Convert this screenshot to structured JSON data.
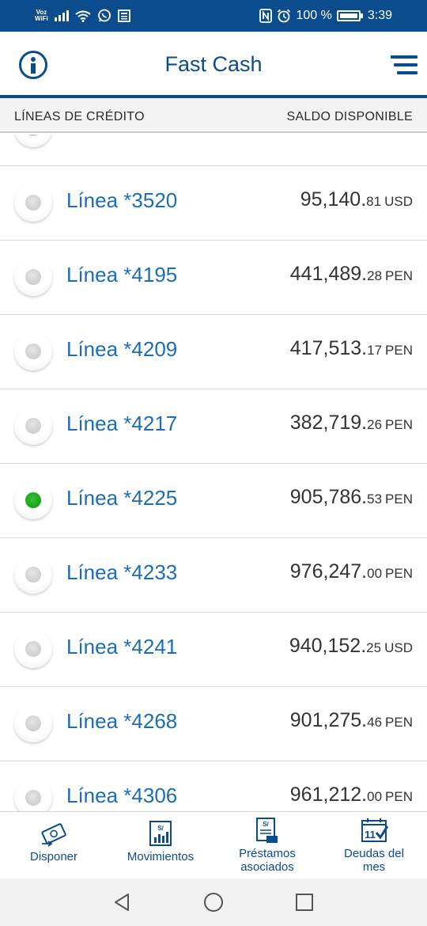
{
  "status_bar": {
    "carrier_top": "Voz",
    "carrier_bottom": "WiFi",
    "battery": "100 %",
    "time": "3:39"
  },
  "header": {
    "title": "Fast Cash",
    "info_icon": "info-icon",
    "menu_icon": "hamburger-menu-icon"
  },
  "columns": {
    "left": "LÍNEAS DE CRÉDITO",
    "right": "SALDO DISPONIBLE"
  },
  "lines": [
    {
      "label": "Línea *3520",
      "int": "95,140.",
      "dec": "81",
      "cur": "USD",
      "selected": false
    },
    {
      "label": "Línea *4195",
      "int": "441,489.",
      "dec": "28",
      "cur": "PEN",
      "selected": false
    },
    {
      "label": "Línea *4209",
      "int": "417,513.",
      "dec": "17",
      "cur": "PEN",
      "selected": false
    },
    {
      "label": "Línea *4217",
      "int": "382,719.",
      "dec": "26",
      "cur": "PEN",
      "selected": false
    },
    {
      "label": "Línea *4225",
      "int": "905,786.",
      "dec": "53",
      "cur": "PEN",
      "selected": true
    },
    {
      "label": "Línea *4233",
      "int": "976,247.",
      "dec": "00",
      "cur": "PEN",
      "selected": false
    },
    {
      "label": "Línea *4241",
      "int": "940,152.",
      "dec": "25",
      "cur": "USD",
      "selected": false
    },
    {
      "label": "Línea *4268",
      "int": "901,275.",
      "dec": "46",
      "cur": "PEN",
      "selected": false
    },
    {
      "label": "Línea *4306",
      "int": "961,212.",
      "dec": "00",
      "cur": "PEN",
      "selected": false
    }
  ],
  "bottom_nav": {
    "disponer": "Disponer",
    "movimientos": "Movimientos",
    "prestamos_1": "Préstamos",
    "prestamos_2": "asociados",
    "deudas_1": "Deudas del",
    "deudas_2": "mes",
    "currency_symbol": "S/",
    "calendar_day": "11"
  },
  "colors": {
    "brand": "#0b4c8c",
    "link": "#1b6db6",
    "selected": "#13a013"
  }
}
